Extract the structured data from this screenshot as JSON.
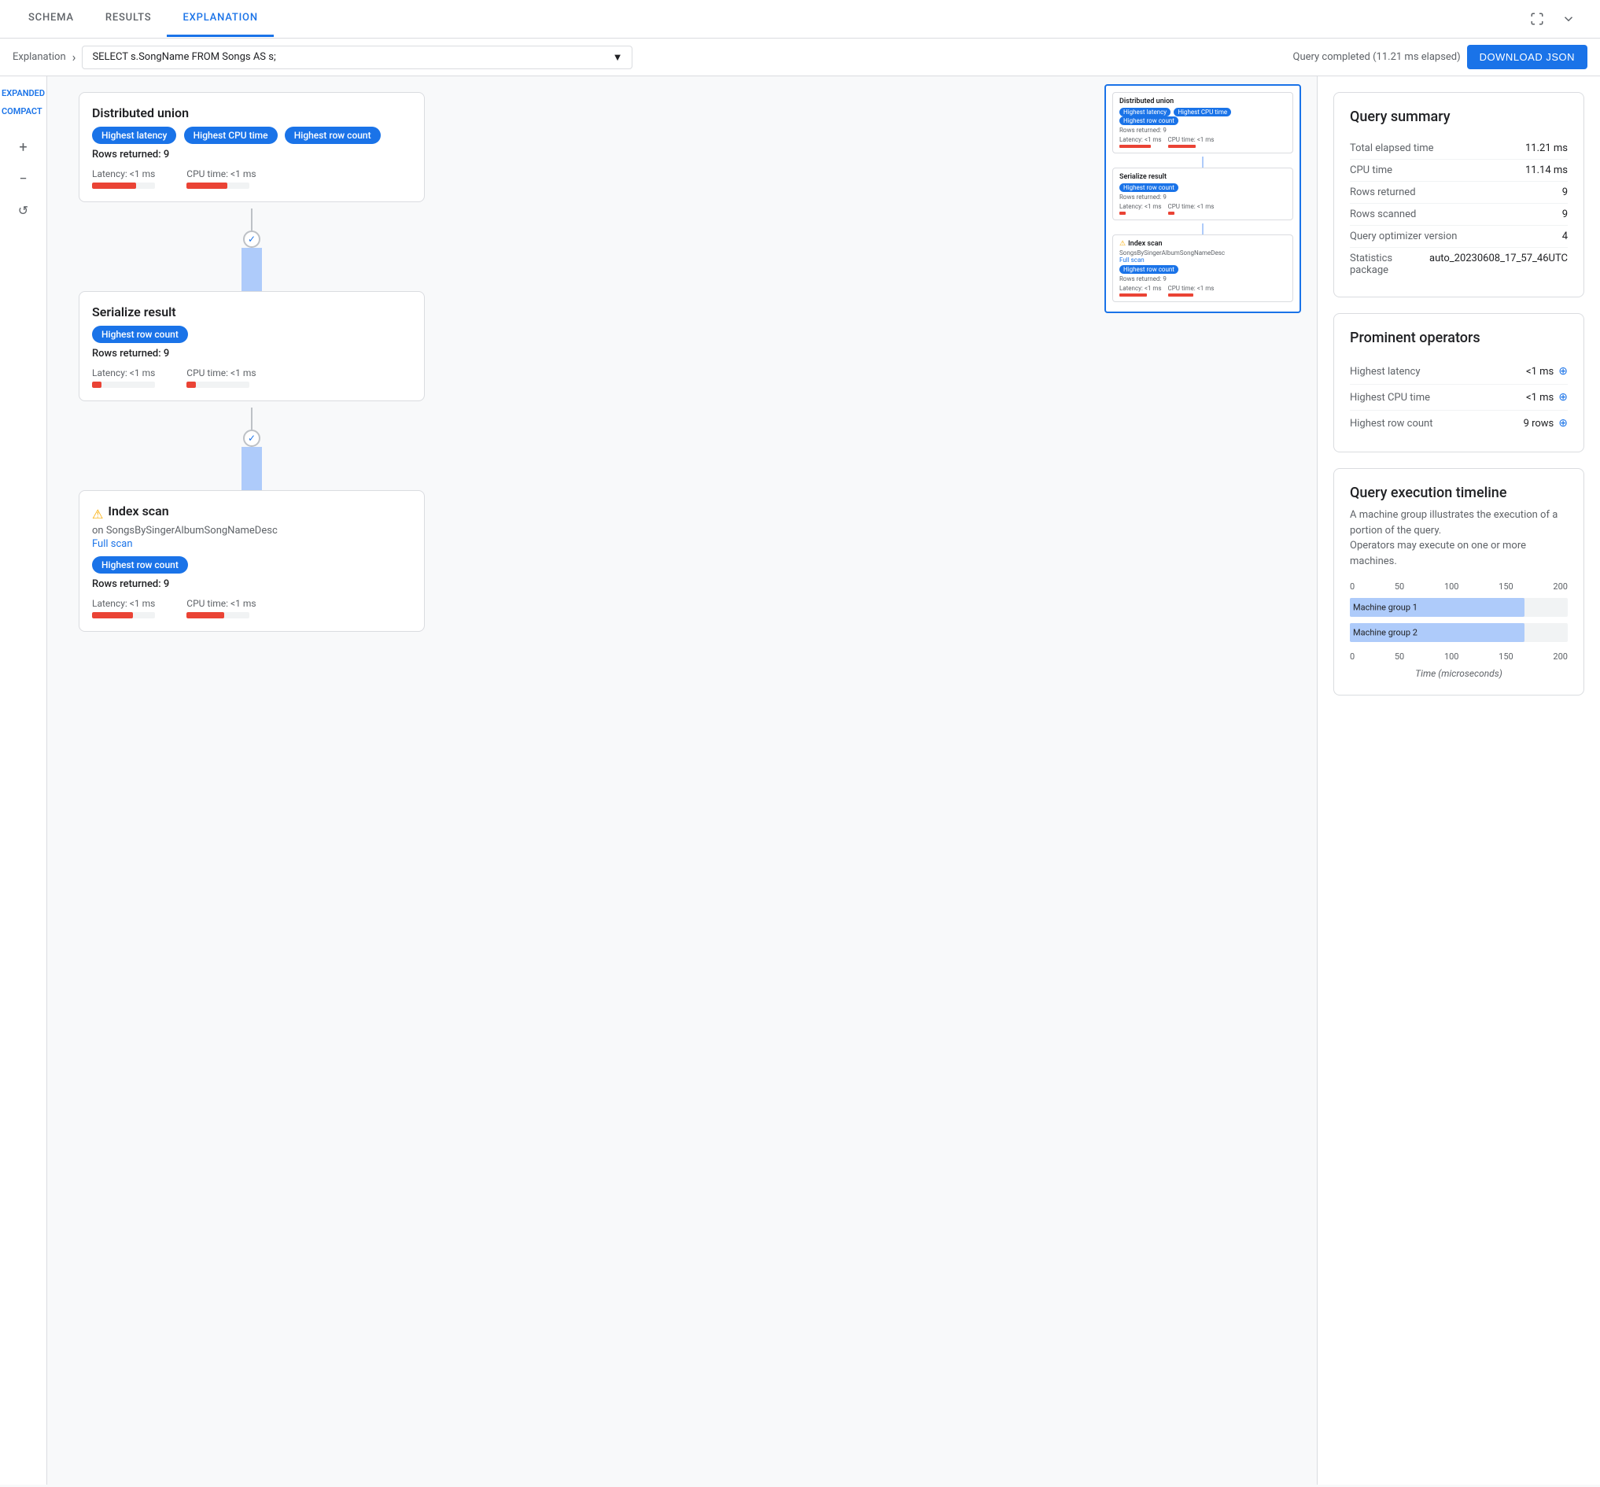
{
  "tabs": [
    {
      "label": "SCHEMA",
      "active": false
    },
    {
      "label": "RESULTS",
      "active": false
    },
    {
      "label": "EXPLANATION",
      "active": true
    }
  ],
  "header": {
    "breadcrumb_label": "Explanation",
    "query_text": "SELECT s.SongName FROM Songs AS s;",
    "query_status": "Query completed (11.21 ms elapsed)",
    "download_btn": "DOWNLOAD JSON",
    "fullscreen_icon": "fullscreen",
    "expand_icon": "expand"
  },
  "view_toggle": {
    "expanded": "EXPANDED",
    "compact": "COMPACT"
  },
  "zoom": {
    "plus": "+",
    "minus": "−",
    "reset": "↺"
  },
  "nodes": [
    {
      "id": "distributed-union",
      "title": "Distributed union",
      "badges": [
        "Highest latency",
        "Highest CPU time",
        "Highest row count"
      ],
      "rows_returned": "Rows returned: 9",
      "latency_label": "Latency: <1 ms",
      "cpu_label": "CPU time: <1 ms",
      "latency_bar_width": "70%",
      "cpu_bar_width": "65%"
    },
    {
      "id": "serialize-result",
      "title": "Serialize result",
      "badges": [
        "Highest row count"
      ],
      "rows_returned": "Rows returned: 9",
      "latency_label": "Latency: <1 ms",
      "cpu_label": "CPU time: <1 ms",
      "latency_bar_width": "15%",
      "cpu_bar_width": "15%"
    },
    {
      "id": "index-scan",
      "title": "Index scan",
      "warning": true,
      "on_text": "on SongsBySingerAlbumSongNameDesc",
      "scan_type": "Full scan",
      "badges": [
        "Highest row count"
      ],
      "rows_returned": "Rows returned: 9",
      "latency_label": "Latency: <1 ms",
      "cpu_label": "CPU time: <1 ms",
      "latency_bar_width": "65%",
      "cpu_bar_width": "60%"
    }
  ],
  "query_summary": {
    "title": "Query summary",
    "rows": [
      {
        "label": "Total elapsed time",
        "value": "11.21 ms"
      },
      {
        "label": "CPU time",
        "value": "11.14 ms"
      },
      {
        "label": "Rows returned",
        "value": "9"
      },
      {
        "label": "Rows scanned",
        "value": "9"
      },
      {
        "label": "Query optimizer version",
        "value": "4"
      },
      {
        "label": "Statistics package",
        "value": "auto_20230608_17_57_46UTC"
      }
    ]
  },
  "prominent_operators": {
    "title": "Prominent operators",
    "rows": [
      {
        "label": "Highest latency",
        "value": "<1 ms"
      },
      {
        "label": "Highest CPU time",
        "value": "<1 ms"
      },
      {
        "label": "Highest row count",
        "value": "9 rows"
      }
    ]
  },
  "timeline": {
    "title": "Query execution timeline",
    "description": "A machine group illustrates the execution of a portion of the query.\nOperators may execute on one or more machines.",
    "x_axis_top": [
      "0",
      "50",
      "100",
      "150",
      "200"
    ],
    "x_axis_bottom": [
      "0",
      "50",
      "100",
      "150",
      "200"
    ],
    "x_label": "Time (microseconds)",
    "bars": [
      {
        "label": "Machine group 1",
        "width_percent": 80,
        "text": "Machine group 1"
      },
      {
        "label": "Machine group 2",
        "width_percent": 80,
        "text": "Machine group 2"
      }
    ]
  },
  "minimap": {
    "nodes": [
      {
        "title": "Distributed union",
        "badges": [
          "Highest latency",
          "Highest CPU time",
          "Highest row count"
        ],
        "rows": "Rows returned: 9",
        "has_bars": true
      },
      {
        "title": "Serialize result",
        "badges": [
          "Highest row count"
        ],
        "rows": "Rows returned: 9",
        "has_bars": true
      },
      {
        "title": "Index scan",
        "warning": true,
        "on": "SongsBySingerAlbumSongNameDesc",
        "scan": "Full scan",
        "badges": [
          "Highest row count"
        ],
        "rows": "Rows returned: 9",
        "has_bars": true
      }
    ]
  }
}
